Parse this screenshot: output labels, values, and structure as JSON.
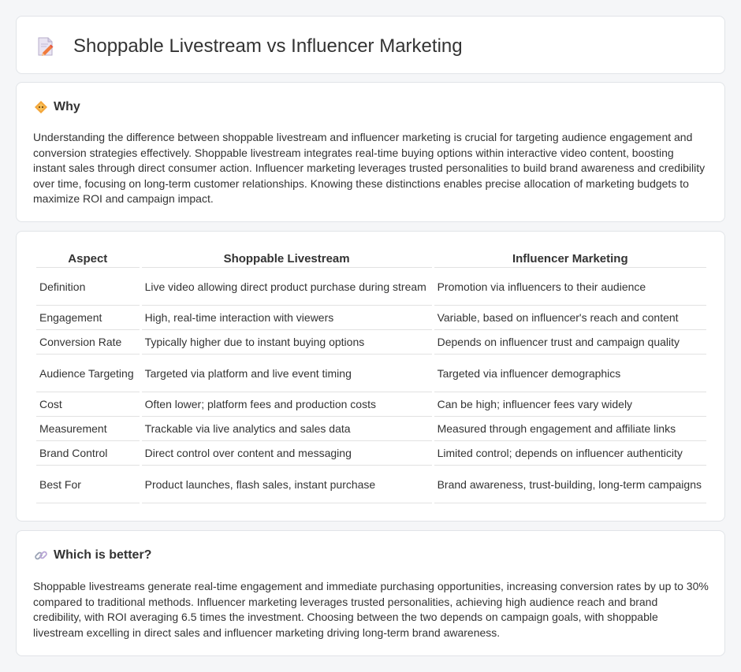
{
  "header": {
    "title": "Shoppable Livestream vs Influencer Marketing",
    "icon": "document-pencil-icon"
  },
  "why": {
    "title": "Why",
    "icon": "diamond-icon",
    "text": "Understanding the difference between shoppable livestream and influencer marketing is crucial for targeting audience engagement and conversion strategies effectively. Shoppable livestream integrates real-time buying options within interactive video content, boosting instant sales through direct consumer action. Influencer marketing leverages trusted personalities to build brand awareness and credibility over time, focusing on long-term customer relationships. Knowing these distinctions enables precise allocation of marketing budgets to maximize ROI and campaign impact."
  },
  "table": {
    "headers": [
      "Aspect",
      "Shoppable Livestream",
      "Influencer Marketing"
    ],
    "rows": [
      [
        "Definition",
        "Live video allowing direct product purchase during stream",
        "Promotion via influencers to their audience"
      ],
      [
        "Engagement",
        "High, real-time interaction with viewers",
        "Variable, based on influencer's reach and content"
      ],
      [
        "Conversion Rate",
        "Typically higher due to instant buying options",
        "Depends on influencer trust and campaign quality"
      ],
      [
        "Audience Targeting",
        "Targeted via platform and live event timing",
        "Targeted via influencer demographics"
      ],
      [
        "Cost",
        "Often lower; platform fees and production costs",
        "Can be high; influencer fees vary widely"
      ],
      [
        "Measurement",
        "Trackable via live analytics and sales data",
        "Measured through engagement and affiliate links"
      ],
      [
        "Brand Control",
        "Direct control over content and messaging",
        "Limited control; depends on influencer authenticity"
      ],
      [
        "Best For",
        "Product launches, flash sales, instant purchase",
        "Brand awareness, trust-building, long-term campaigns"
      ]
    ]
  },
  "better": {
    "title": "Which is better?",
    "icon": "link-icon",
    "text": "Shoppable livestreams generate real-time engagement and immediate purchasing opportunities, increasing conversion rates by up to 30% compared to traditional methods. Influencer marketing leverages trusted personalities, achieving high audience reach and brand credibility, with ROI averaging 6.5 times the investment. Choosing between the two depends on campaign goals, with shoppable livestream excelling in direct sales and influencer marketing driving long-term brand awareness."
  },
  "colors": {
    "page_bg": "#f5f6f8",
    "card_bg": "#ffffff",
    "text": "#333333",
    "accent_orange": "#f0a030"
  }
}
